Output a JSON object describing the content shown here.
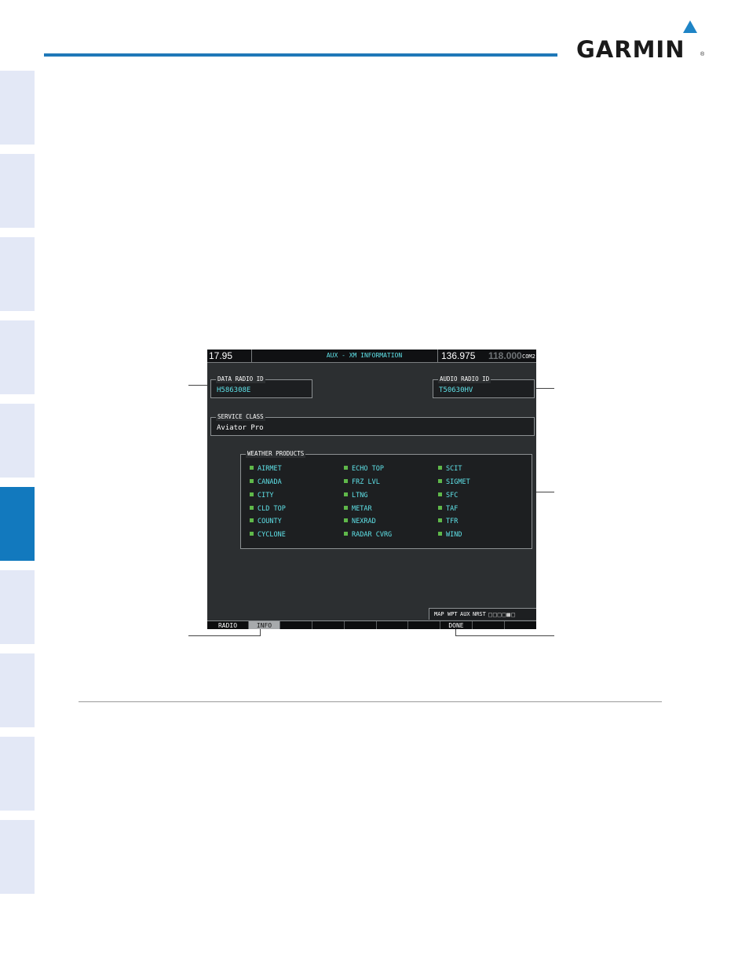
{
  "brand": {
    "name": "GARMIN",
    "registered_mark": "®",
    "accent": "#1e84c6"
  },
  "side_tabs": {
    "count": 10,
    "active_index": 5,
    "active_color": "#1279be",
    "inactive_color": "#e3e8f6"
  },
  "display": {
    "nav_freq": "17.95",
    "page_title": "AUX - XM INFORMATION",
    "com_active": "136.975",
    "com_standby": "118.000",
    "com_label": "COM2",
    "data_radio": {
      "label": "DATA RADIO ID",
      "value": "H586308E"
    },
    "audio_radio": {
      "label": "AUDIO RADIO ID",
      "value": "T50630HV"
    },
    "service_class": {
      "label": "SERVICE CLASS",
      "value": "Aviator Pro"
    },
    "weather_products": {
      "label": "WEATHER PRODUCTS",
      "columns": [
        [
          "AIRMET",
          "CANADA",
          "CITY",
          "CLD TOP",
          "COUNTY",
          "CYCLONE"
        ],
        [
          "ECHO TOP",
          "FRZ LVL",
          "LTNG",
          "METAR",
          "NEXRAD",
          "RADAR CVRG"
        ],
        [
          "SCIT",
          "SIGMET",
          "SFC",
          "TAF",
          "TFR",
          "WIND"
        ]
      ]
    },
    "page_group": {
      "labels": [
        "MAP",
        "WPT",
        "AUX",
        "NRST"
      ],
      "active": "AUX",
      "dots": "□□□□■□"
    },
    "softkeys": [
      "RADIO",
      "INFO",
      "",
      "",
      "",
      "",
      "",
      "DONE",
      "",
      ""
    ],
    "softkey_selected": "INFO"
  }
}
